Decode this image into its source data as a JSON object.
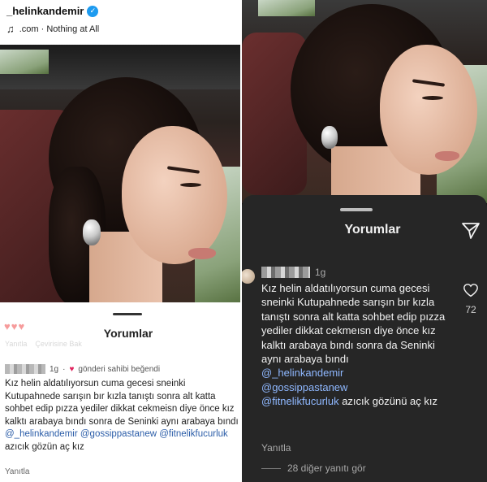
{
  "left": {
    "header": {
      "username": "_helinkandemir",
      "music_text": ".com · Nothing at All",
      "verified_icon": "verified-badge-icon",
      "music_icon": "music-note-icon"
    },
    "sheet": {
      "title": "Yorumlar",
      "ghost_reply": "Yanıtla",
      "ghost_translate": "Çevirisine Bak",
      "liked_by_author": "gönderi sahibi beğendi",
      "time": "1g",
      "comment_text": "Kız helin aldatılıyorsun cuma gecesi sneinki Kutupahnede sarışın bır kızla tanıştı sonra alt katta sohbet edip pızza yediler dikkat cekmeisn diye önce kız kalktı arabaya bındı sonra de Seninki aynı arabaya bındı",
      "mentions": [
        "@_helinkandemir",
        "@gossippastanew",
        "@fitnelikfucurluk"
      ],
      "tail_text": "azıcık gözün aç kız",
      "reply_label": "Yanıtla"
    }
  },
  "right": {
    "sheet": {
      "title": "Yorumlar",
      "time": "1g",
      "comment_text": "Kız helin aldatılıyorsun cuma gecesi sneinki Kutupahnede sarışın bır kızla tanıştı sonra alt katta sohbet edip pızza yediler dikkat cekmeısn diye önce kız kalktı arabaya bındı sonra da Seninki aynı arabaya bındı",
      "mentions": [
        "@_helinkandemir",
        "@gossippastanew",
        "@fitnelikfucurluk"
      ],
      "tail_text": "azıcık gözünü aç kız",
      "like_count": "72",
      "reply_label": "Yanıtla",
      "more_replies": "28 diğer yanıtı gör"
    }
  },
  "colors": {
    "mention_light": "#2b5da8",
    "mention_dark": "#8fb8ff",
    "sheet_dark": "#262626",
    "heart_red": "#e0245e"
  }
}
